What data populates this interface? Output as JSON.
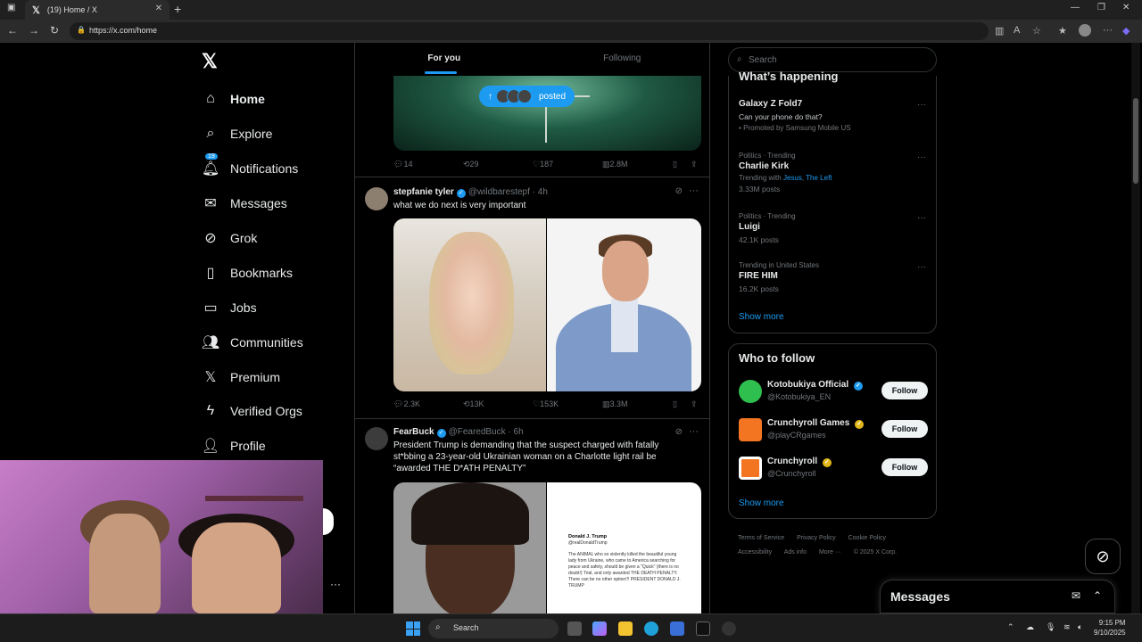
{
  "browser": {
    "tab_title": "(19) Home / X",
    "url": "https://x.com/home"
  },
  "nav": {
    "items": [
      {
        "label": "Home"
      },
      {
        "label": "Explore"
      },
      {
        "label": "Notifications",
        "badge": "19"
      },
      {
        "label": "Messages"
      },
      {
        "label": "Grok"
      },
      {
        "label": "Bookmarks"
      },
      {
        "label": "Jobs"
      },
      {
        "label": "Communities"
      },
      {
        "label": "Premium"
      },
      {
        "label": "Verified Orgs"
      },
      {
        "label": "Profile"
      }
    ]
  },
  "feed": {
    "tabs": [
      "For you",
      "Following"
    ],
    "posted_pill": "posted",
    "post1_actions": {
      "replies": "14",
      "reposts": "29",
      "likes": "187",
      "views": "2.8M"
    },
    "post2": {
      "name": "stepfanie tyler",
      "handle": "@wildbarestepf",
      "time": "· 4h",
      "text": "what we do next is very important",
      "actions": {
        "replies": "2.3K",
        "reposts": "13K",
        "likes": "153K",
        "views": "3.3M"
      }
    },
    "post3": {
      "name": "FearBuck",
      "handle": "@FearedBuck",
      "time": "· 6h",
      "text": "President Trump is demanding that the suspect charged with fatally st*bbing a 23-year-old Ukrainian woman on a Charlotte light rail be “awarded THE D*ATH PENALTY”",
      "embed_name": "Donald J. Trump",
      "embed_handle": "@realDonaldTrump",
      "embed_text": "The ANIMAL who so violently killed the beautiful young lady from Ukraine, who came to America searching for peace and safety, should be given a \"Quick\" (there is no doubt!) Trial, and only awarded THE DEATH PENALTY. There can be no other option!!! PRESIDENT DONALD J. TRUMP"
    }
  },
  "right": {
    "search_placeholder": "Search",
    "whats_happening": "What’s happening",
    "trends": [
      {
        "context": "",
        "title": "Galaxy Z Fold7",
        "sub": "Can your phone do that?",
        "promo": "Promoted by Samsung Mobile US"
      },
      {
        "context": "Politics · Trending",
        "title": "Charlie Kirk",
        "sub_prefix": "Trending with ",
        "links": [
          "Jesus",
          "The Left"
        ],
        "count": "3.33M posts"
      },
      {
        "context": "Politics · Trending",
        "title": "Luigi",
        "count": "42.1K posts"
      },
      {
        "context": "Trending in United States",
        "title": "FIRE HIM",
        "count": "16.2K posts"
      }
    ],
    "show_more": "Show more",
    "who_to_follow": "Who to follow",
    "follow_suggestions": [
      {
        "name": "Kotobukiya Official",
        "handle": "@Kotobukiya_EN",
        "button": "Follow"
      },
      {
        "name": "Crunchyroll Games",
        "handle": "@playCRgames",
        "button": "Follow"
      },
      {
        "name": "Crunchyroll",
        "handle": "@Crunchyroll",
        "button": "Follow"
      }
    ],
    "footer": [
      "Terms of Service",
      "Privacy Policy",
      "Cookie Policy",
      "Accessibility",
      "Ads info",
      "More ···",
      "© 2025 X Corp."
    ]
  },
  "messages_drawer": {
    "title": "Messages"
  },
  "taskbar": {
    "search": "Search",
    "time": "9:15 PM",
    "date": "9/10/2025"
  },
  "colors": {
    "accent": "#1d9bf0",
    "bg": "#000000",
    "border": "#2f3336"
  }
}
